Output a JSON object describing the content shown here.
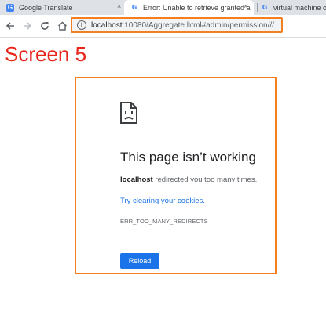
{
  "tabs": [
    {
      "icon": "google-translate-icon",
      "title": "Google Translate",
      "close": "×"
    },
    {
      "icon": "google-g-icon",
      "title": "Error: Unable to retrieve granted a",
      "close": "×"
    },
    {
      "icon": "google-g-icon",
      "title": "virtual machine odk a",
      "close": ""
    }
  ],
  "address_bar": {
    "host": "localhost",
    "path": ":10080/Aggregate.html#admin/permission///"
  },
  "annotation": {
    "label": "Screen 5"
  },
  "error_page": {
    "icon": "sad-page-icon",
    "title": "This page isn’t working",
    "host": "localhost",
    "description": " redirected you too many times.",
    "link": "Try clearing your cookies.",
    "code": "ERR_TOO_MANY_REDIRECTS",
    "reload_label": "Reload"
  },
  "colors": {
    "annotation_orange": "#f47f20",
    "annotation_red": "#e8251a",
    "link_blue": "#1a73e8"
  }
}
